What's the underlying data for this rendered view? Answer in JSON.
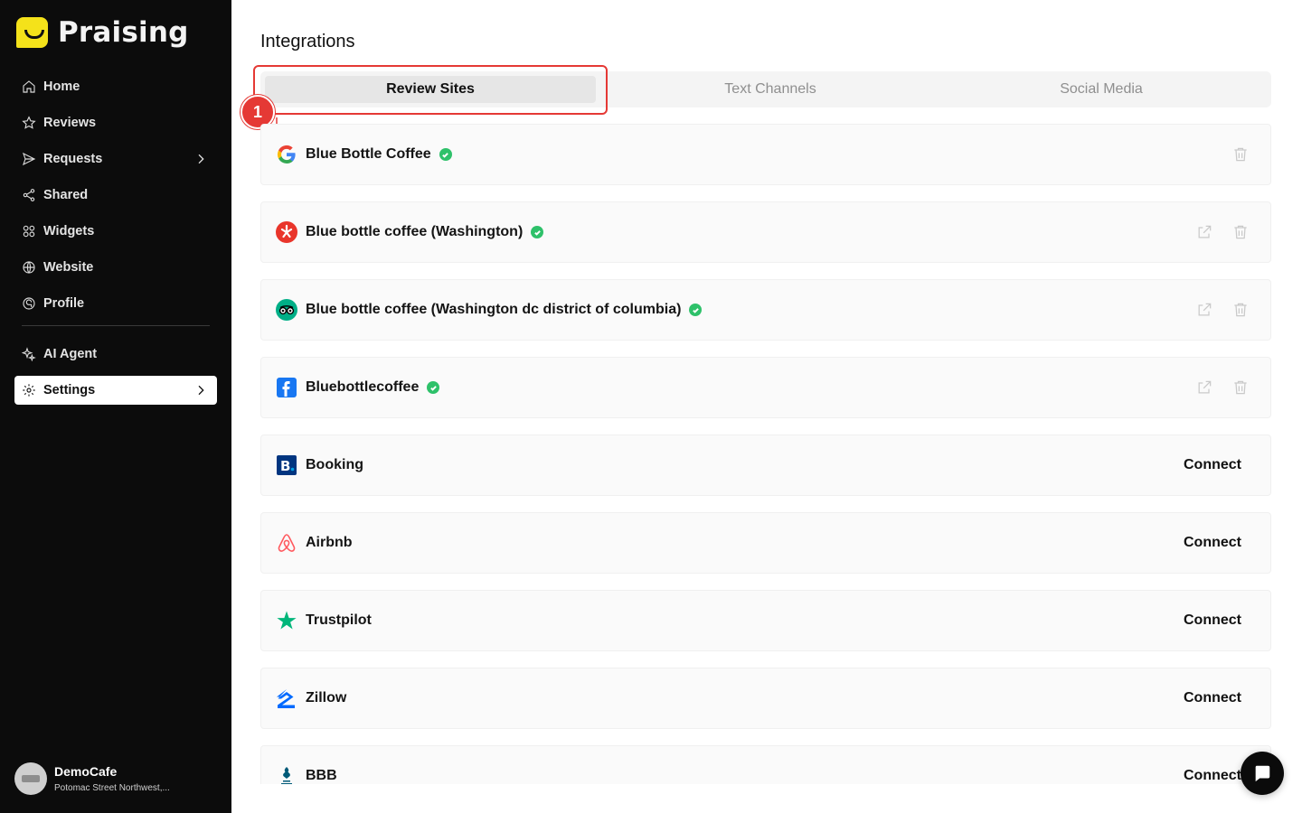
{
  "app": {
    "name": "Praising"
  },
  "sidebar": {
    "items": [
      {
        "label": "Home",
        "icon": "home-icon"
      },
      {
        "label": "Reviews",
        "icon": "star-icon"
      },
      {
        "label": "Requests",
        "icon": "send-icon"
      },
      {
        "label": "Shared",
        "icon": "share-icon"
      },
      {
        "label": "Widgets",
        "icon": "widgets-icon"
      },
      {
        "label": "Website",
        "icon": "globe-icon"
      },
      {
        "label": "Profile",
        "icon": "profile-icon"
      }
    ],
    "secondary": [
      {
        "label": "AI Agent",
        "icon": "sparkle-icon"
      },
      {
        "label": "Settings",
        "icon": "gear-icon",
        "active": true
      }
    ],
    "account": {
      "name": "DemoCafe",
      "address": "Potomac Street Northwest,..."
    }
  },
  "page": {
    "title": "Integrations"
  },
  "annotation": {
    "step": "1"
  },
  "tabs": [
    {
      "label": "Review Sites",
      "active": true
    },
    {
      "label": "Text Channels"
    },
    {
      "label": "Social Media"
    }
  ],
  "integrations": [
    {
      "name": "Blue Bottle Coffee",
      "source": "google",
      "connected": true
    },
    {
      "name": "Blue bottle coffee (Washington)",
      "source": "yelp",
      "connected": true
    },
    {
      "name": "Blue bottle coffee (Washington dc district of columbia)",
      "source": "tripadvisor",
      "connected": true
    },
    {
      "name": "Bluebottlecoffee",
      "source": "facebook",
      "connected": true
    },
    {
      "name": "Booking",
      "source": "booking",
      "action": "Connect"
    },
    {
      "name": "Airbnb",
      "source": "airbnb",
      "action": "Connect"
    },
    {
      "name": "Trustpilot",
      "source": "trustpilot",
      "action": "Connect"
    },
    {
      "name": "Zillow",
      "source": "zillow",
      "action": "Connect"
    },
    {
      "name": "BBB",
      "source": "bbb",
      "action": "Connect"
    }
  ],
  "colors": {
    "sidebar_bg": "#0c0c0c",
    "brand_yellow": "#f4e21a",
    "highlight_red": "#e53935",
    "verified_green": "#2ec16a"
  }
}
